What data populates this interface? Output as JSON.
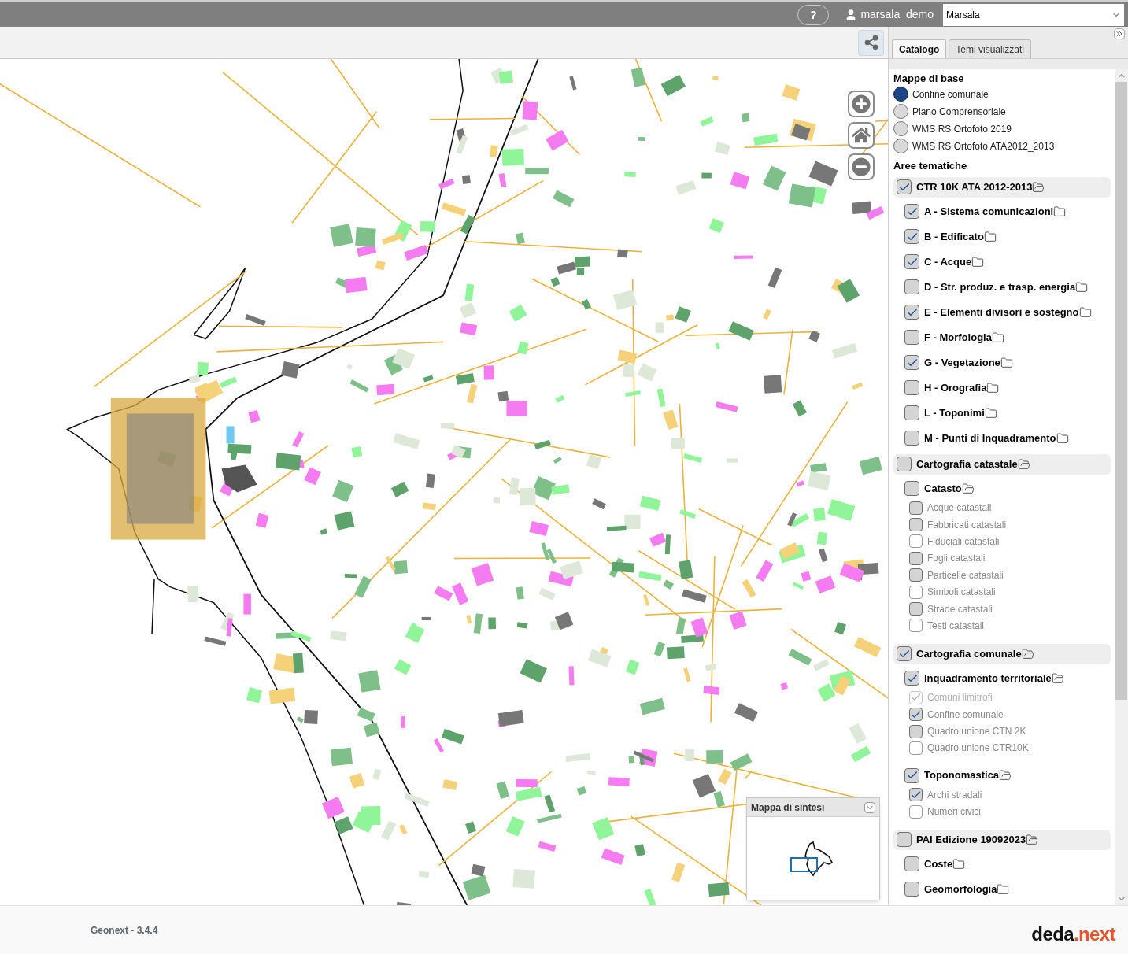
{
  "topbar": {
    "help_label": "?",
    "user": "marsala_demo",
    "municipality": "Marsala"
  },
  "panel": {
    "tabs": [
      {
        "label": "Catalogo",
        "selected": true
      },
      {
        "label": "Temi visualizzati",
        "selected": false
      }
    ],
    "base_maps": {
      "title": "Mappe di base",
      "items": [
        {
          "label": "Confine comunale",
          "selected": true
        },
        {
          "label": "Piano Comprensoriale",
          "selected": false
        },
        {
          "label": "WMS RS Ortofoto 2019",
          "selected": false
        },
        {
          "label": "WMS RS Ortofoto ATA2012_2013",
          "selected": false
        }
      ]
    },
    "thematic": {
      "title": "Aree tematiche",
      "groups": [
        {
          "label": "CTR 10K ATA 2012-2013",
          "checked": true,
          "expanded": true,
          "children": [
            {
              "label": "A - Sistema comunicazioni",
              "checked": true,
              "expanded": false
            },
            {
              "label": "B - Edificato",
              "checked": true,
              "expanded": false
            },
            {
              "label": "C - Acque",
              "checked": true,
              "expanded": false
            },
            {
              "label": "D - Str. produz. e trasp. energia",
              "checked": false,
              "expanded": false
            },
            {
              "label": "E - Elementi divisori e sostegno",
              "checked": true,
              "expanded": false
            },
            {
              "label": "F - Morfologia",
              "checked": false,
              "expanded": false
            },
            {
              "label": "G - Vegetazione",
              "checked": true,
              "expanded": false
            },
            {
              "label": "H - Orografia",
              "checked": false,
              "expanded": false
            },
            {
              "label": "L - Toponimi",
              "checked": false,
              "expanded": false
            },
            {
              "label": "M - Punti di Inquadramento",
              "checked": false,
              "expanded": false
            }
          ]
        },
        {
          "label": "Cartografia catastale",
          "checked": false,
          "expanded": true,
          "children": [
            {
              "label": "Catasto",
              "checked": false,
              "expanded": true,
              "children": [
                {
                  "label": "Acque catastali",
                  "kind": "filled",
                  "checked": false,
                  "disabled": false
                },
                {
                  "label": "Fabbricati catastali",
                  "kind": "filled",
                  "checked": false,
                  "disabled": false
                },
                {
                  "label": "Fiduciali catastali",
                  "kind": "empty",
                  "checked": false,
                  "disabled": false
                },
                {
                  "label": "Fogli catastali",
                  "kind": "filled",
                  "checked": false,
                  "disabled": false
                },
                {
                  "label": "Particelle catastali",
                  "kind": "filled",
                  "checked": false,
                  "disabled": false
                },
                {
                  "label": "Simboli catastali",
                  "kind": "empty",
                  "checked": false,
                  "disabled": false
                },
                {
                  "label": "Strade catastali",
                  "kind": "filled",
                  "checked": false,
                  "disabled": false
                },
                {
                  "label": "Testi catastali",
                  "kind": "empty",
                  "checked": false,
                  "disabled": false
                }
              ]
            }
          ]
        },
        {
          "label": "Cartografia comunale",
          "checked": true,
          "expanded": true,
          "children": [
            {
              "label": "Inquadramento territoriale",
              "checked": true,
              "expanded": true,
              "children": [
                {
                  "label": "Comuni limitrofi",
                  "kind": "empty",
                  "checked": true,
                  "disabled": true
                },
                {
                  "label": "Confine comunale",
                  "kind": "filled",
                  "checked": true,
                  "disabled": false
                },
                {
                  "label": "Quadro unione CTN 2K",
                  "kind": "filled",
                  "checked": false,
                  "disabled": false
                },
                {
                  "label": "Quadro unione CTR10K",
                  "kind": "empty",
                  "checked": false,
                  "disabled": false
                }
              ]
            },
            {
              "label": "Toponomastica",
              "checked": true,
              "expanded": true,
              "children": [
                {
                  "label": "Archi stradali",
                  "kind": "filled",
                  "checked": true,
                  "disabled": false
                },
                {
                  "label": "Numeri civici",
                  "kind": "empty",
                  "checked": false,
                  "disabled": false
                }
              ]
            }
          ]
        },
        {
          "label": "PAI Edizione 19092023",
          "checked": false,
          "expanded": true,
          "children": [
            {
              "label": "Coste",
              "checked": false,
              "expanded": false
            },
            {
              "label": "Geomorfologia",
              "checked": false,
              "expanded": false
            }
          ]
        }
      ]
    }
  },
  "overview": {
    "title": "Mappa di sintesi"
  },
  "footer": {
    "version": "Geonext - 3.4.4",
    "logo_main": "deda",
    "logo_accent": ".next"
  }
}
